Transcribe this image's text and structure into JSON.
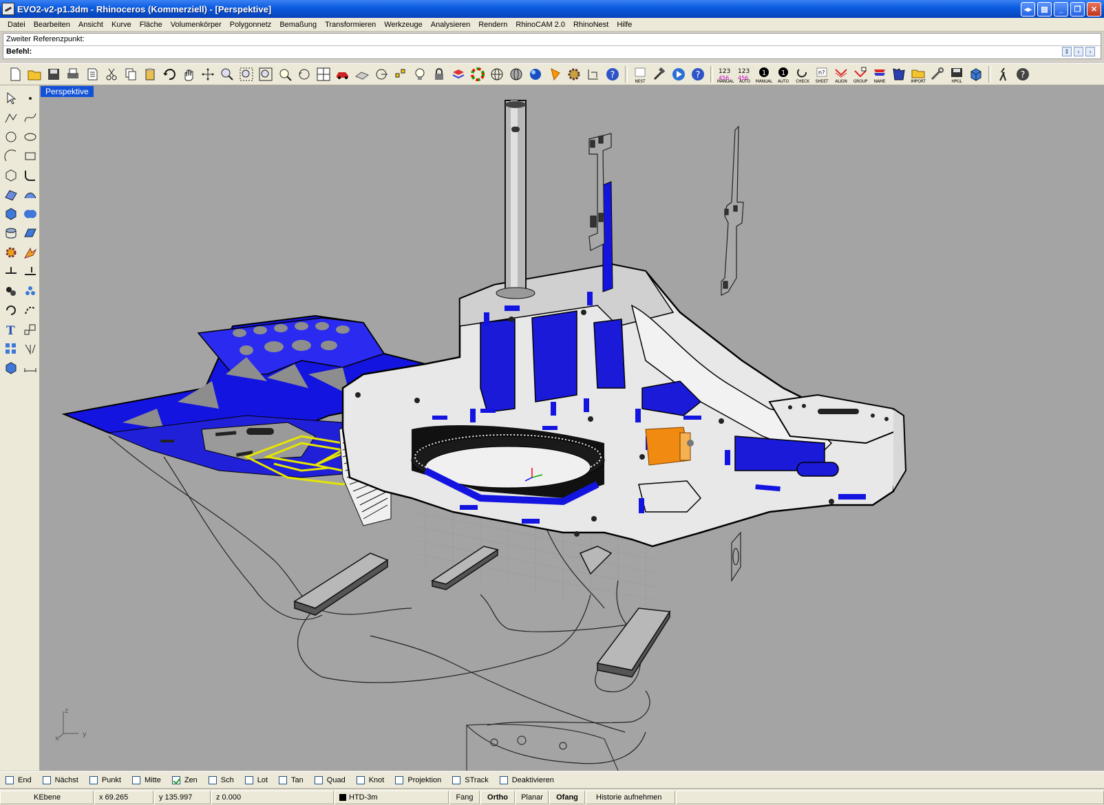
{
  "window": {
    "title": "EVO2-v2-p1.3dm - Rhinoceros (Kommerziell) - [Perspektive]",
    "buttons": [
      "taskbar-toggle",
      "toolbar-toggle",
      "minimize",
      "restore",
      "close"
    ]
  },
  "menu": [
    "Datei",
    "Bearbeiten",
    "Ansicht",
    "Kurve",
    "Fläche",
    "Volumenkörper",
    "Polygonnetz",
    "Bemaßung",
    "Transformieren",
    "Werkzeuge",
    "Analysieren",
    "Rendern",
    "RhinoCAM 2.0",
    "RhinoNest",
    "Hilfe"
  ],
  "command": {
    "history": "Zweiter Referenzpunkt:",
    "label": "Befehl:",
    "value": ""
  },
  "toolbar_captions": {
    "nest": "NEST",
    "manual_456": "MANUAL",
    "auto_456": "AUTO",
    "manual": "MANUAL",
    "auto": "AUTO",
    "check": "CHECK",
    "sheet": "SHEET",
    "align": "ALIGN",
    "group": "GROUP",
    "name": "NAME",
    "import": "IMPORT",
    "hpgl": "HPGL"
  },
  "viewport": {
    "label": "Perspektive",
    "axis_labels": {
      "z": "z",
      "x": "x",
      "y": "y"
    }
  },
  "osnaps": [
    {
      "label": "End",
      "checked": false
    },
    {
      "label": "Nächst",
      "checked": false
    },
    {
      "label": "Punkt",
      "checked": false
    },
    {
      "label": "Mitte",
      "checked": false
    },
    {
      "label": "Zen",
      "checked": true
    },
    {
      "label": "Sch",
      "checked": false
    },
    {
      "label": "Lot",
      "checked": false
    },
    {
      "label": "Tan",
      "checked": false
    },
    {
      "label": "Quad",
      "checked": false
    },
    {
      "label": "Knot",
      "checked": false
    },
    {
      "label": "Projektion",
      "checked": false
    },
    {
      "label": "STrack",
      "checked": false
    },
    {
      "label": "Deaktivieren",
      "checked": false
    }
  ],
  "status": {
    "cplane": "KEbene",
    "x": "x 69.265",
    "y": "y 135.997",
    "z": "z 0.000",
    "layer": "HTD-3m",
    "fang": "Fang",
    "ortho": "Ortho",
    "planar": "Planar",
    "ofang": "Ofang",
    "history": "Historie aufnehmen"
  },
  "colors": {
    "title_bar": "#0a5ae0",
    "viewport_bg": "#a4a4a4",
    "tab_bg": "#1352d6",
    "frame_blue": "#1010e0",
    "frame_white": "#e8e8e8",
    "selected_yellow": "#e6e600",
    "servo_orange": "#f08a10"
  }
}
